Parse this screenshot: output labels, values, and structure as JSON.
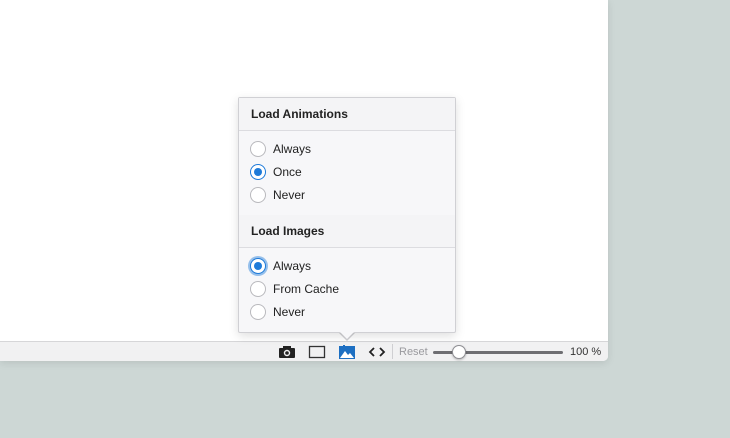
{
  "popover": {
    "animations": {
      "title": "Load Animations",
      "options": [
        "Always",
        "Once",
        "Never"
      ],
      "selected": "Once"
    },
    "images": {
      "title": "Load Images",
      "options": [
        "Always",
        "From Cache",
        "Never"
      ],
      "selected": "Always"
    }
  },
  "statusbar": {
    "icons": [
      "camera-icon",
      "responsive-rect-icon",
      "image-icon",
      "code-icon"
    ],
    "active_icon": "image-icon",
    "reset_label": "Reset",
    "zoom_label": "100 %",
    "zoom_fraction": 0.2
  },
  "colors": {
    "accent": "#1d7ad9",
    "background": "#cdd7d5"
  }
}
